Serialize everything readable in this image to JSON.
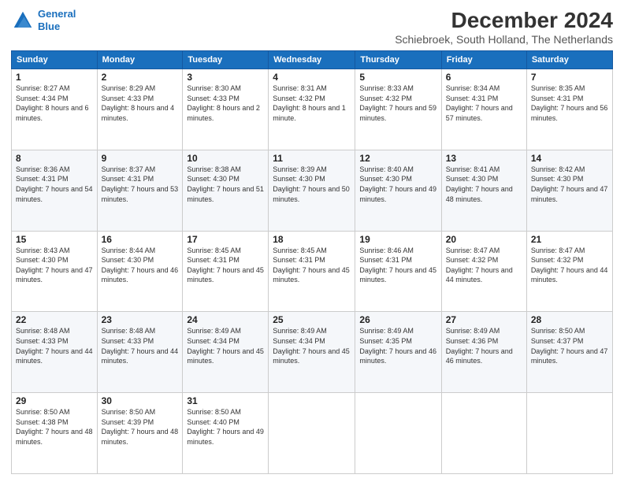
{
  "logo": {
    "line1": "General",
    "line2": "Blue"
  },
  "title": "December 2024",
  "subtitle": "Schiebroek, South Holland, The Netherlands",
  "weekdays": [
    "Sunday",
    "Monday",
    "Tuesday",
    "Wednesday",
    "Thursday",
    "Friday",
    "Saturday"
  ],
  "weeks": [
    [
      {
        "day": "1",
        "sunrise": "Sunrise: 8:27 AM",
        "sunset": "Sunset: 4:34 PM",
        "daylight": "Daylight: 8 hours and 6 minutes."
      },
      {
        "day": "2",
        "sunrise": "Sunrise: 8:29 AM",
        "sunset": "Sunset: 4:33 PM",
        "daylight": "Daylight: 8 hours and 4 minutes."
      },
      {
        "day": "3",
        "sunrise": "Sunrise: 8:30 AM",
        "sunset": "Sunset: 4:33 PM",
        "daylight": "Daylight: 8 hours and 2 minutes."
      },
      {
        "day": "4",
        "sunrise": "Sunrise: 8:31 AM",
        "sunset": "Sunset: 4:32 PM",
        "daylight": "Daylight: 8 hours and 1 minute."
      },
      {
        "day": "5",
        "sunrise": "Sunrise: 8:33 AM",
        "sunset": "Sunset: 4:32 PM",
        "daylight": "Daylight: 7 hours and 59 minutes."
      },
      {
        "day": "6",
        "sunrise": "Sunrise: 8:34 AM",
        "sunset": "Sunset: 4:31 PM",
        "daylight": "Daylight: 7 hours and 57 minutes."
      },
      {
        "day": "7",
        "sunrise": "Sunrise: 8:35 AM",
        "sunset": "Sunset: 4:31 PM",
        "daylight": "Daylight: 7 hours and 56 minutes."
      }
    ],
    [
      {
        "day": "8",
        "sunrise": "Sunrise: 8:36 AM",
        "sunset": "Sunset: 4:31 PM",
        "daylight": "Daylight: 7 hours and 54 minutes."
      },
      {
        "day": "9",
        "sunrise": "Sunrise: 8:37 AM",
        "sunset": "Sunset: 4:31 PM",
        "daylight": "Daylight: 7 hours and 53 minutes."
      },
      {
        "day": "10",
        "sunrise": "Sunrise: 8:38 AM",
        "sunset": "Sunset: 4:30 PM",
        "daylight": "Daylight: 7 hours and 51 minutes."
      },
      {
        "day": "11",
        "sunrise": "Sunrise: 8:39 AM",
        "sunset": "Sunset: 4:30 PM",
        "daylight": "Daylight: 7 hours and 50 minutes."
      },
      {
        "day": "12",
        "sunrise": "Sunrise: 8:40 AM",
        "sunset": "Sunset: 4:30 PM",
        "daylight": "Daylight: 7 hours and 49 minutes."
      },
      {
        "day": "13",
        "sunrise": "Sunrise: 8:41 AM",
        "sunset": "Sunset: 4:30 PM",
        "daylight": "Daylight: 7 hours and 48 minutes."
      },
      {
        "day": "14",
        "sunrise": "Sunrise: 8:42 AM",
        "sunset": "Sunset: 4:30 PM",
        "daylight": "Daylight: 7 hours and 47 minutes."
      }
    ],
    [
      {
        "day": "15",
        "sunrise": "Sunrise: 8:43 AM",
        "sunset": "Sunset: 4:30 PM",
        "daylight": "Daylight: 7 hours and 47 minutes."
      },
      {
        "day": "16",
        "sunrise": "Sunrise: 8:44 AM",
        "sunset": "Sunset: 4:30 PM",
        "daylight": "Daylight: 7 hours and 46 minutes."
      },
      {
        "day": "17",
        "sunrise": "Sunrise: 8:45 AM",
        "sunset": "Sunset: 4:31 PM",
        "daylight": "Daylight: 7 hours and 45 minutes."
      },
      {
        "day": "18",
        "sunrise": "Sunrise: 8:45 AM",
        "sunset": "Sunset: 4:31 PM",
        "daylight": "Daylight: 7 hours and 45 minutes."
      },
      {
        "day": "19",
        "sunrise": "Sunrise: 8:46 AM",
        "sunset": "Sunset: 4:31 PM",
        "daylight": "Daylight: 7 hours and 45 minutes."
      },
      {
        "day": "20",
        "sunrise": "Sunrise: 8:47 AM",
        "sunset": "Sunset: 4:32 PM",
        "daylight": "Daylight: 7 hours and 44 minutes."
      },
      {
        "day": "21",
        "sunrise": "Sunrise: 8:47 AM",
        "sunset": "Sunset: 4:32 PM",
        "daylight": "Daylight: 7 hours and 44 minutes."
      }
    ],
    [
      {
        "day": "22",
        "sunrise": "Sunrise: 8:48 AM",
        "sunset": "Sunset: 4:33 PM",
        "daylight": "Daylight: 7 hours and 44 minutes."
      },
      {
        "day": "23",
        "sunrise": "Sunrise: 8:48 AM",
        "sunset": "Sunset: 4:33 PM",
        "daylight": "Daylight: 7 hours and 44 minutes."
      },
      {
        "day": "24",
        "sunrise": "Sunrise: 8:49 AM",
        "sunset": "Sunset: 4:34 PM",
        "daylight": "Daylight: 7 hours and 45 minutes."
      },
      {
        "day": "25",
        "sunrise": "Sunrise: 8:49 AM",
        "sunset": "Sunset: 4:34 PM",
        "daylight": "Daylight: 7 hours and 45 minutes."
      },
      {
        "day": "26",
        "sunrise": "Sunrise: 8:49 AM",
        "sunset": "Sunset: 4:35 PM",
        "daylight": "Daylight: 7 hours and 46 minutes."
      },
      {
        "day": "27",
        "sunrise": "Sunrise: 8:49 AM",
        "sunset": "Sunset: 4:36 PM",
        "daylight": "Daylight: 7 hours and 46 minutes."
      },
      {
        "day": "28",
        "sunrise": "Sunrise: 8:50 AM",
        "sunset": "Sunset: 4:37 PM",
        "daylight": "Daylight: 7 hours and 47 minutes."
      }
    ],
    [
      {
        "day": "29",
        "sunrise": "Sunrise: 8:50 AM",
        "sunset": "Sunset: 4:38 PM",
        "daylight": "Daylight: 7 hours and 48 minutes."
      },
      {
        "day": "30",
        "sunrise": "Sunrise: 8:50 AM",
        "sunset": "Sunset: 4:39 PM",
        "daylight": "Daylight: 7 hours and 48 minutes."
      },
      {
        "day": "31",
        "sunrise": "Sunrise: 8:50 AM",
        "sunset": "Sunset: 4:40 PM",
        "daylight": "Daylight: 7 hours and 49 minutes."
      },
      null,
      null,
      null,
      null
    ]
  ]
}
